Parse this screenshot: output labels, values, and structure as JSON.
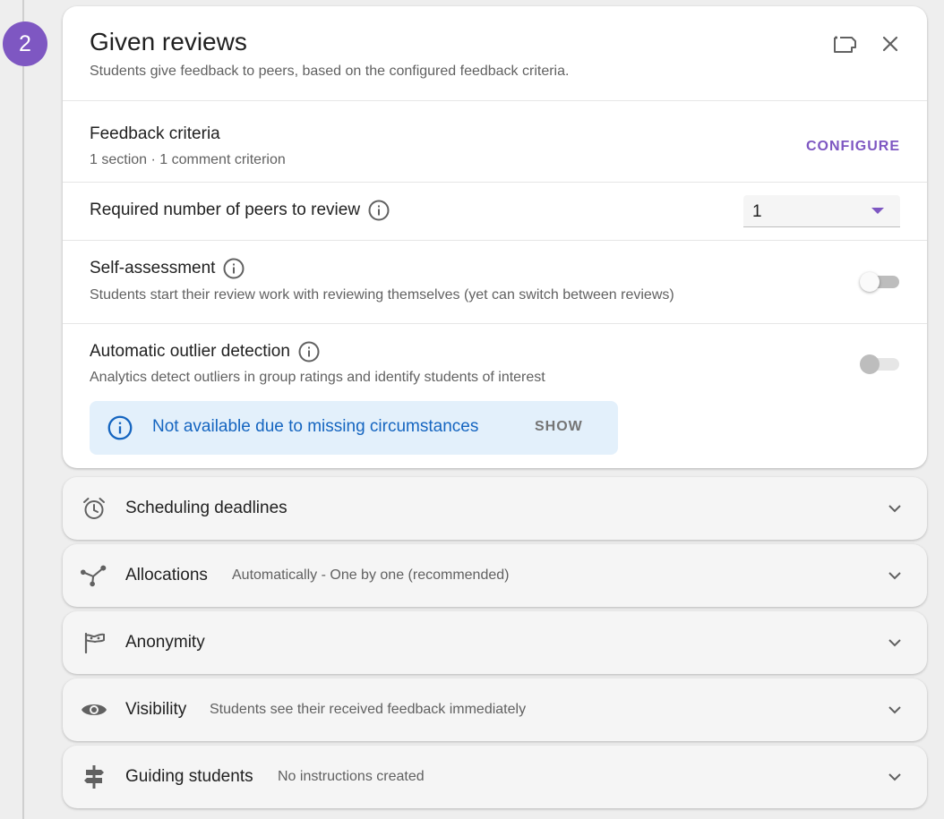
{
  "step": {
    "number": "2"
  },
  "header": {
    "title": "Given reviews",
    "subtitle": "Students give feedback to peers, based on the configured feedback criteria.",
    "add_icon": "add-section-icon",
    "close_icon": "close-icon"
  },
  "feedback_criteria": {
    "title": "Feedback criteria",
    "summary": "1 section · 1 comment criterion",
    "action_label": "CONFIGURE"
  },
  "peers": {
    "title": "Required number of peers to review",
    "selected": "1"
  },
  "self_assessment": {
    "title": "Self-assessment",
    "description": "Students start their review work with reviewing themselves (yet can switch between reviews)",
    "enabled": false
  },
  "outlier_detection": {
    "title": "Automatic outlier detection",
    "description": "Analytics detect outliers in group ratings and identify students of interest",
    "enabled": false,
    "disabled": true,
    "notice": {
      "text": "Not available due to missing circumstances",
      "action_label": "SHOW"
    }
  },
  "accordions": [
    {
      "title": "Scheduling deadlines",
      "subtitle": "",
      "icon": "alarm-icon"
    },
    {
      "title": "Allocations",
      "subtitle": "Automatically - One by one (recommended)",
      "icon": "share-icon"
    },
    {
      "title": "Anonymity",
      "subtitle": "",
      "icon": "mask-icon"
    },
    {
      "title": "Visibility",
      "subtitle": "Students see their received feedback immediately",
      "icon": "eye-icon"
    },
    {
      "title": "Guiding students",
      "subtitle": "No instructions created",
      "icon": "signpost-icon"
    }
  ],
  "colors": {
    "accent": "#7e57c2",
    "notice_bg": "#e3f0fb",
    "notice_text": "#1565c0"
  }
}
